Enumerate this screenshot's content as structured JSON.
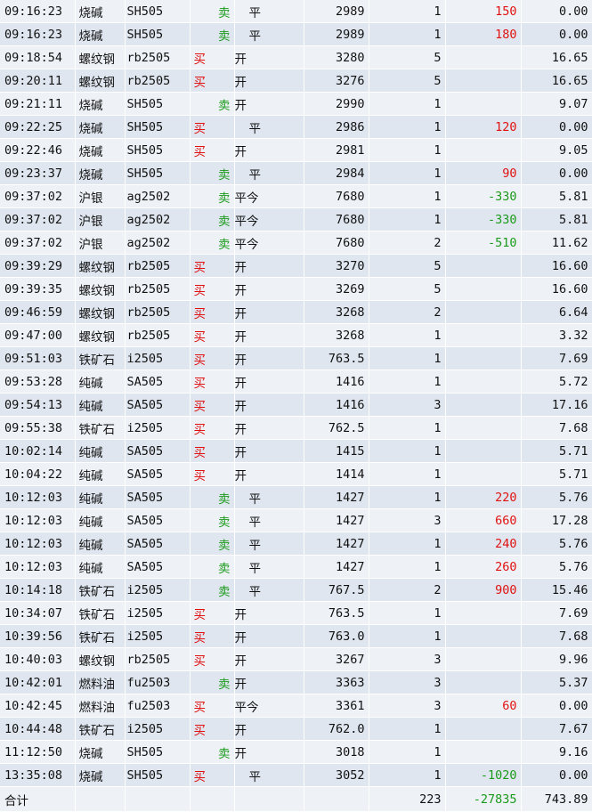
{
  "colors": {
    "buy": "#e01010",
    "sell": "#1a9a1a",
    "row_light": "#eef2f7",
    "row_dark": "#dfe6ef"
  },
  "rows": [
    {
      "time": "09:16:23",
      "name": "烧碱",
      "code": "SH505",
      "dir": "卖",
      "side": "sell",
      "oc": "平",
      "price": "2989",
      "qty": "1",
      "pl": "150",
      "plc": "pos",
      "fee": "0.00"
    },
    {
      "time": "09:16:23",
      "name": "烧碱",
      "code": "SH505",
      "dir": "卖",
      "side": "sell",
      "oc": "平",
      "price": "2989",
      "qty": "1",
      "pl": "180",
      "plc": "pos",
      "fee": "0.00"
    },
    {
      "time": "09:18:54",
      "name": "螺纹钢",
      "code": "rb2505",
      "dir": "买",
      "side": "buy",
      "oc": "开",
      "price": "3280",
      "qty": "5",
      "pl": "",
      "plc": "",
      "fee": "16.65"
    },
    {
      "time": "09:20:11",
      "name": "螺纹钢",
      "code": "rb2505",
      "dir": "买",
      "side": "buy",
      "oc": "开",
      "price": "3276",
      "qty": "5",
      "pl": "",
      "plc": "",
      "fee": "16.65"
    },
    {
      "time": "09:21:11",
      "name": "烧碱",
      "code": "SH505",
      "dir": "卖",
      "side": "sell",
      "oc": "开",
      "price": "2990",
      "qty": "1",
      "pl": "",
      "plc": "",
      "fee": "9.07"
    },
    {
      "time": "09:22:25",
      "name": "烧碱",
      "code": "SH505",
      "dir": "买",
      "side": "buy",
      "oc": "平",
      "price": "2986",
      "qty": "1",
      "pl": "120",
      "plc": "pos",
      "fee": "0.00"
    },
    {
      "time": "09:22:46",
      "name": "烧碱",
      "code": "SH505",
      "dir": "买",
      "side": "buy",
      "oc": "开",
      "price": "2981",
      "qty": "1",
      "pl": "",
      "plc": "",
      "fee": "9.05"
    },
    {
      "time": "09:23:37",
      "name": "烧碱",
      "code": "SH505",
      "dir": "卖",
      "side": "sell",
      "oc": "平",
      "price": "2984",
      "qty": "1",
      "pl": "90",
      "plc": "pos",
      "fee": "0.00"
    },
    {
      "time": "09:37:02",
      "name": "沪银",
      "code": "ag2502",
      "dir": "卖",
      "side": "sell",
      "oc": "平今",
      "price": "7680",
      "qty": "1",
      "pl": "-330",
      "plc": "neg",
      "fee": "5.81"
    },
    {
      "time": "09:37:02",
      "name": "沪银",
      "code": "ag2502",
      "dir": "卖",
      "side": "sell",
      "oc": "平今",
      "price": "7680",
      "qty": "1",
      "pl": "-330",
      "plc": "neg",
      "fee": "5.81"
    },
    {
      "time": "09:37:02",
      "name": "沪银",
      "code": "ag2502",
      "dir": "卖",
      "side": "sell",
      "oc": "平今",
      "price": "7680",
      "qty": "2",
      "pl": "-510",
      "plc": "neg",
      "fee": "11.62"
    },
    {
      "time": "09:39:29",
      "name": "螺纹钢",
      "code": "rb2505",
      "dir": "买",
      "side": "buy",
      "oc": "开",
      "price": "3270",
      "qty": "5",
      "pl": "",
      "plc": "",
      "fee": "16.60"
    },
    {
      "time": "09:39:35",
      "name": "螺纹钢",
      "code": "rb2505",
      "dir": "买",
      "side": "buy",
      "oc": "开",
      "price": "3269",
      "qty": "5",
      "pl": "",
      "plc": "",
      "fee": "16.60"
    },
    {
      "time": "09:46:59",
      "name": "螺纹钢",
      "code": "rb2505",
      "dir": "买",
      "side": "buy",
      "oc": "开",
      "price": "3268",
      "qty": "2",
      "pl": "",
      "plc": "",
      "fee": "6.64"
    },
    {
      "time": "09:47:00",
      "name": "螺纹钢",
      "code": "rb2505",
      "dir": "买",
      "side": "buy",
      "oc": "开",
      "price": "3268",
      "qty": "1",
      "pl": "",
      "plc": "",
      "fee": "3.32"
    },
    {
      "time": "09:51:03",
      "name": "铁矿石",
      "code": "i2505",
      "dir": "买",
      "side": "buy",
      "oc": "开",
      "price": "763.5",
      "qty": "1",
      "pl": "",
      "plc": "",
      "fee": "7.69"
    },
    {
      "time": "09:53:28",
      "name": "纯碱",
      "code": "SA505",
      "dir": "买",
      "side": "buy",
      "oc": "开",
      "price": "1416",
      "qty": "1",
      "pl": "",
      "plc": "",
      "fee": "5.72"
    },
    {
      "time": "09:54:13",
      "name": "纯碱",
      "code": "SA505",
      "dir": "买",
      "side": "buy",
      "oc": "开",
      "price": "1416",
      "qty": "3",
      "pl": "",
      "plc": "",
      "fee": "17.16"
    },
    {
      "time": "09:55:38",
      "name": "铁矿石",
      "code": "i2505",
      "dir": "买",
      "side": "buy",
      "oc": "开",
      "price": "762.5",
      "qty": "1",
      "pl": "",
      "plc": "",
      "fee": "7.68"
    },
    {
      "time": "10:02:14",
      "name": "纯碱",
      "code": "SA505",
      "dir": "买",
      "side": "buy",
      "oc": "开",
      "price": "1415",
      "qty": "1",
      "pl": "",
      "plc": "",
      "fee": "5.71"
    },
    {
      "time": "10:04:22",
      "name": "纯碱",
      "code": "SA505",
      "dir": "买",
      "side": "buy",
      "oc": "开",
      "price": "1414",
      "qty": "1",
      "pl": "",
      "plc": "",
      "fee": "5.71"
    },
    {
      "time": "10:12:03",
      "name": "纯碱",
      "code": "SA505",
      "dir": "卖",
      "side": "sell",
      "oc": "平",
      "price": "1427",
      "qty": "1",
      "pl": "220",
      "plc": "pos",
      "fee": "5.76"
    },
    {
      "time": "10:12:03",
      "name": "纯碱",
      "code": "SA505",
      "dir": "卖",
      "side": "sell",
      "oc": "平",
      "price": "1427",
      "qty": "3",
      "pl": "660",
      "plc": "pos",
      "fee": "17.28"
    },
    {
      "time": "10:12:03",
      "name": "纯碱",
      "code": "SA505",
      "dir": "卖",
      "side": "sell",
      "oc": "平",
      "price": "1427",
      "qty": "1",
      "pl": "240",
      "plc": "pos",
      "fee": "5.76"
    },
    {
      "time": "10:12:03",
      "name": "纯碱",
      "code": "SA505",
      "dir": "卖",
      "side": "sell",
      "oc": "平",
      "price": "1427",
      "qty": "1",
      "pl": "260",
      "plc": "pos",
      "fee": "5.76"
    },
    {
      "time": "10:14:18",
      "name": "铁矿石",
      "code": "i2505",
      "dir": "卖",
      "side": "sell",
      "oc": "平",
      "price": "767.5",
      "qty": "2",
      "pl": "900",
      "plc": "pos",
      "fee": "15.46"
    },
    {
      "time": "10:34:07",
      "name": "铁矿石",
      "code": "i2505",
      "dir": "买",
      "side": "buy",
      "oc": "开",
      "price": "763.5",
      "qty": "1",
      "pl": "",
      "plc": "",
      "fee": "7.69"
    },
    {
      "time": "10:39:56",
      "name": "铁矿石",
      "code": "i2505",
      "dir": "买",
      "side": "buy",
      "oc": "开",
      "price": "763.0",
      "qty": "1",
      "pl": "",
      "plc": "",
      "fee": "7.68"
    },
    {
      "time": "10:40:03",
      "name": "螺纹钢",
      "code": "rb2505",
      "dir": "买",
      "side": "buy",
      "oc": "开",
      "price": "3267",
      "qty": "3",
      "pl": "",
      "plc": "",
      "fee": "9.96"
    },
    {
      "time": "10:42:01",
      "name": "燃料油",
      "code": "fu2503",
      "dir": "卖",
      "side": "sell",
      "oc": "开",
      "price": "3363",
      "qty": "3",
      "pl": "",
      "plc": "",
      "fee": "5.37"
    },
    {
      "time": "10:42:45",
      "name": "燃料油",
      "code": "fu2503",
      "dir": "买",
      "side": "buy",
      "oc": "平今",
      "price": "3361",
      "qty": "3",
      "pl": "60",
      "plc": "pos",
      "fee": "0.00"
    },
    {
      "time": "10:44:48",
      "name": "铁矿石",
      "code": "i2505",
      "dir": "买",
      "side": "buy",
      "oc": "开",
      "price": "762.0",
      "qty": "1",
      "pl": "",
      "plc": "",
      "fee": "7.67"
    },
    {
      "time": "11:12:50",
      "name": "烧碱",
      "code": "SH505",
      "dir": "卖",
      "side": "sell",
      "oc": "开",
      "price": "3018",
      "qty": "1",
      "pl": "",
      "plc": "",
      "fee": "9.16"
    },
    {
      "time": "13:35:08",
      "name": "烧碱",
      "code": "SH505",
      "dir": "买",
      "side": "buy",
      "oc": "平",
      "price": "3052",
      "qty": "1",
      "pl": "-1020",
      "plc": "neg",
      "fee": "0.00"
    }
  ],
  "total": {
    "label": "合计",
    "qty": "223",
    "pl": "-27835",
    "fee": "743.89"
  }
}
